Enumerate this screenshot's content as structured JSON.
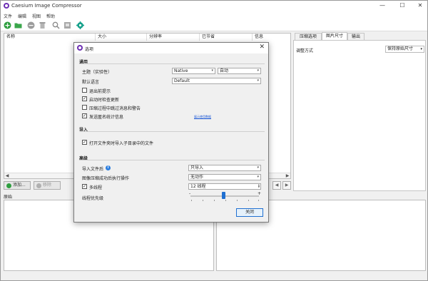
{
  "app": {
    "title": "Caesium Image Compressor",
    "window_controls": [
      "—",
      "☐",
      "✕"
    ]
  },
  "menu": [
    "文件",
    "编辑",
    "视图",
    "帮助"
  ],
  "toolbar_icons": [
    "add-icon",
    "folder-icon",
    "remove-icon",
    "clear-icon",
    "search-icon",
    "compress-icon",
    "settings-icon"
  ],
  "file_list": {
    "columns": [
      "名称",
      "大小",
      "分辨率",
      "已节省",
      "信息"
    ]
  },
  "actions": {
    "add_label": "添加...",
    "remove_label": "移除"
  },
  "preview": {
    "original_label": "原始"
  },
  "right_panel": {
    "tabs": [
      "压缩选项",
      "图片尺寸",
      "输出"
    ],
    "active_tab": 1,
    "resize_label": "调整方式",
    "resize_value": "保持原始尺寸"
  },
  "dialog": {
    "title": "选项",
    "close": "✕",
    "general": {
      "heading": "通用",
      "theme_label": "主题（实验性）",
      "theme_value": "Native",
      "theme_mode_value": "自动",
      "language_label": "默认语言",
      "language_value": "Default",
      "exit_prompt": "退出前提示",
      "auto_update": "启动时检查更新",
      "skip_messages": "压缩过程中跳过消息和警告",
      "send_stats": "发送匿名统计信息",
      "privacy_link": "展示使用数据"
    },
    "import": {
      "heading": "导入",
      "subfolders": "打开文件夹时导入子目录中的文件"
    },
    "advanced": {
      "heading": "高级",
      "import_files_label": "导入文件后",
      "import_files_value": "只导入",
      "post_compress_label": "图像压缩成功后执行操作",
      "post_compress_value": "无动作",
      "multithread_label": "多线程",
      "multithread_value": "12 线程",
      "priority_label": "线程优先级",
      "priority_minus": "-",
      "priority_plus": "+"
    },
    "close_button": "关闭"
  },
  "checkbox_states": {
    "exit_prompt": false,
    "auto_update": true,
    "skip_messages": false,
    "send_stats": true,
    "subfolders": true,
    "multithread": true
  },
  "colors": {
    "accent": "#1f6fd1",
    "brand": "#6d2fb3",
    "add": "#2e9e3f",
    "settings": "#14a08a"
  }
}
